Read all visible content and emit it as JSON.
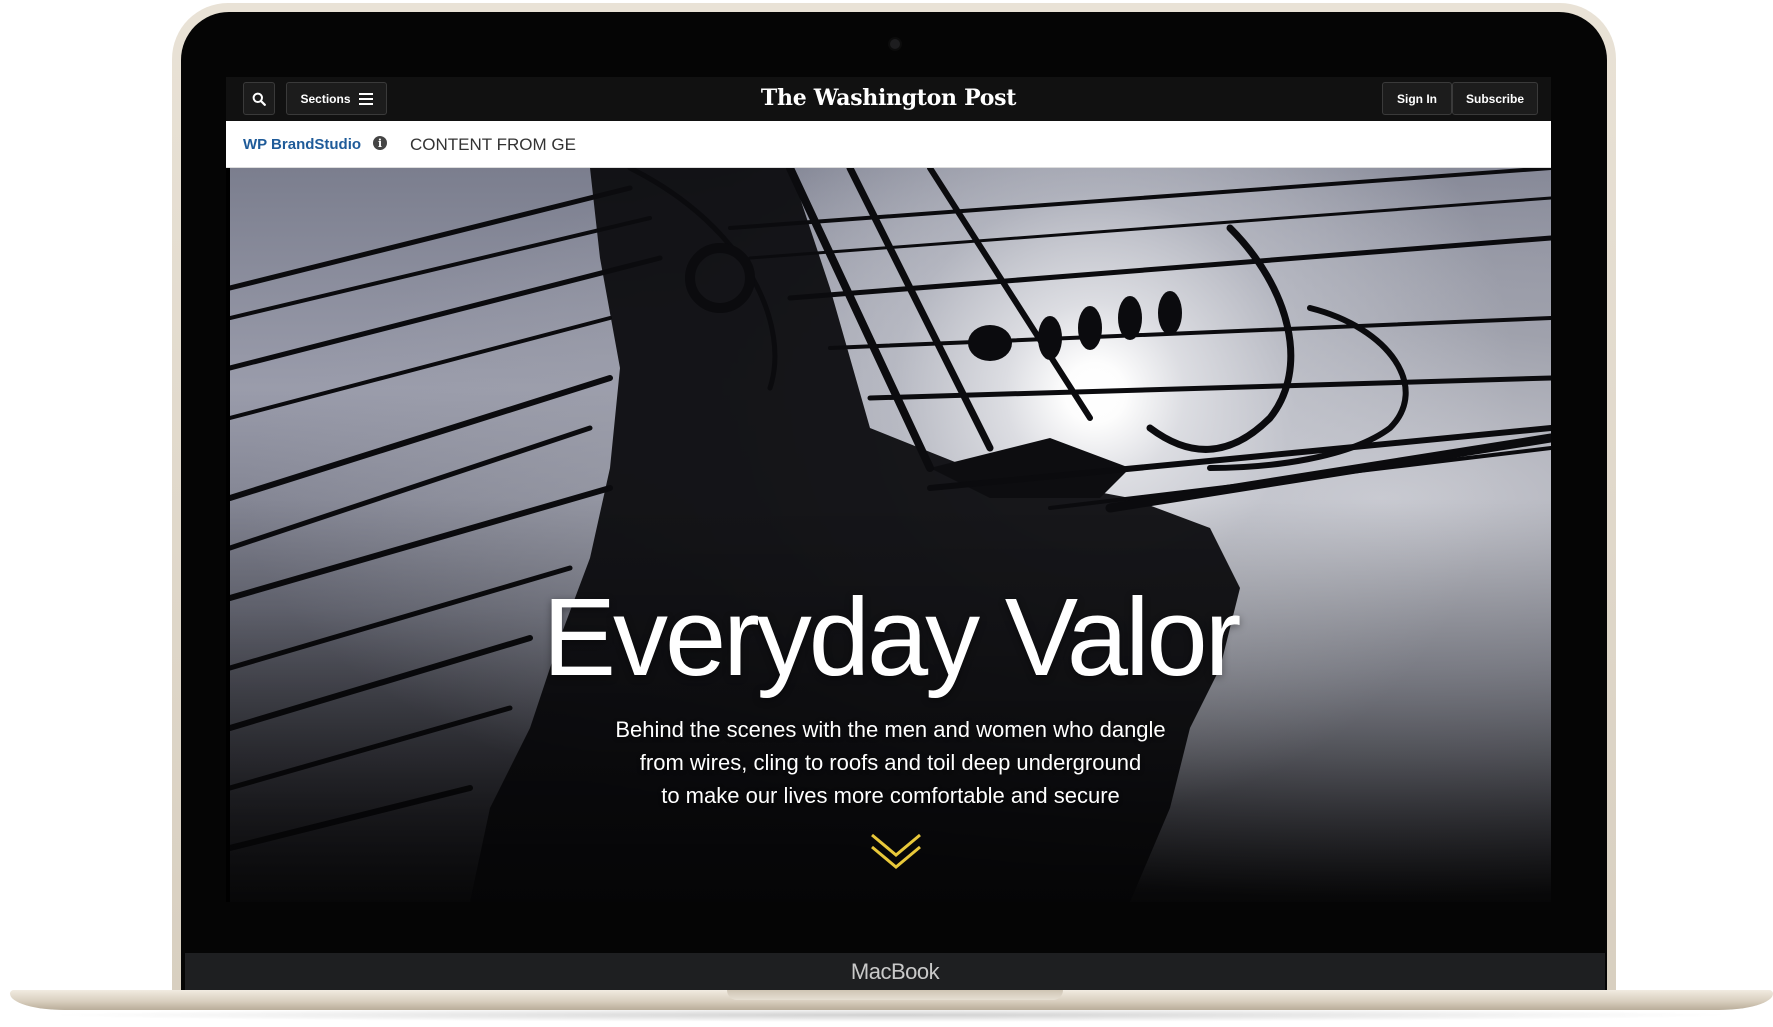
{
  "device": {
    "label": "MacBook"
  },
  "topbar": {
    "sections_label": "Sections",
    "masthead": "The Washington Post",
    "signin_label": "Sign In",
    "subscribe_label": "Subscribe",
    "icons": [
      "search-icon",
      "menu-icon"
    ]
  },
  "brandbar": {
    "brand": "WP BrandStudio",
    "info_glyph": "i",
    "content_from": "CONTENT FROM GE",
    "brand_color": "#1f5b99"
  },
  "hero": {
    "title": "Everyday Valor",
    "subtitle_lines": [
      "Behind the scenes with the men and women who dangle",
      "from wires, cling to roofs and toil deep underground",
      "to make our lives more comfortable and secure"
    ],
    "scroll_icon": "chevron-down-double-icon",
    "scroll_icon_color": "#e8c83a"
  }
}
